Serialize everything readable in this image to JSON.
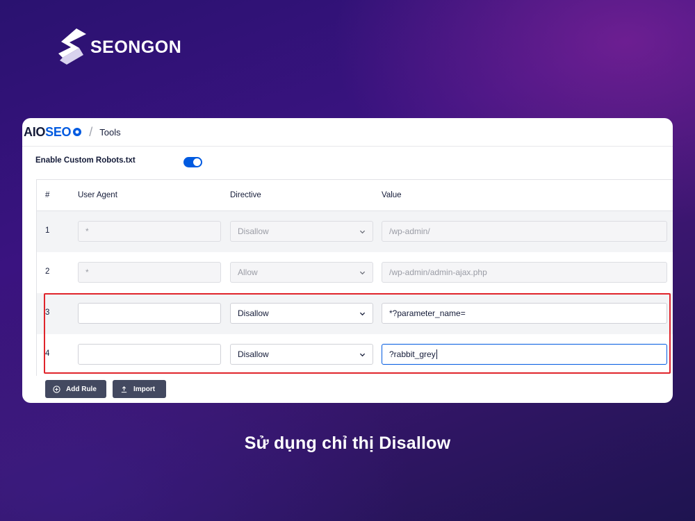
{
  "brand": {
    "name": "SEONGON",
    "icon": "seongon-s-logo"
  },
  "app": {
    "logo_prefix": "AIO",
    "logo_accent": "SEO",
    "breadcrumb_sep": "/",
    "breadcrumb": "Tools"
  },
  "settings": {
    "toggle_label": "Enable Custom Robots.txt",
    "toggle_on": true
  },
  "table": {
    "headers": {
      "num": "#",
      "user_agent": "User Agent",
      "directive": "Directive",
      "value": "Value"
    },
    "rows": [
      {
        "num": "1",
        "user_agent": "*",
        "directive": "Disallow",
        "value": "/wp-admin/"
      },
      {
        "num": "2",
        "user_agent": "*",
        "directive": "Allow",
        "value": "/wp-admin/admin-ajax.php"
      },
      {
        "num": "3",
        "user_agent": "",
        "directive": "Disallow",
        "value": "*?parameter_name="
      },
      {
        "num": "4",
        "user_agent": "",
        "directive": "Disallow",
        "value": "?rabbit_grey"
      }
    ]
  },
  "buttons": {
    "add_rule": "Add Rule",
    "import": "Import"
  },
  "colors": {
    "accent": "#005ae0",
    "highlight": "#e0242b",
    "button": "#434960"
  },
  "caption": "Sử dụng chỉ thị Disallow"
}
